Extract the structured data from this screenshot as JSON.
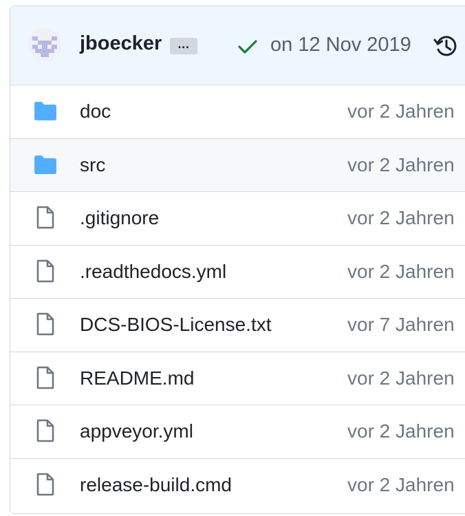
{
  "commit": {
    "author": "jboecker",
    "ellipsis": "…",
    "date": "on 12 Nov 2019",
    "status": "success",
    "status_color": "#1a7f37"
  },
  "files": [
    {
      "name": "doc",
      "type": "folder",
      "age": "vor 2 Jahren"
    },
    {
      "name": "src",
      "type": "folder",
      "age": "vor 2 Jahren"
    },
    {
      "name": ".gitignore",
      "type": "file",
      "age": "vor 2 Jahren"
    },
    {
      "name": ".readthedocs.yml",
      "type": "file",
      "age": "vor 2 Jahren"
    },
    {
      "name": "DCS-BIOS-License.txt",
      "type": "file",
      "age": "vor 7 Jahren"
    },
    {
      "name": "README.md",
      "type": "file",
      "age": "vor 2 Jahren"
    },
    {
      "name": "appveyor.yml",
      "type": "file",
      "age": "vor 2 Jahren"
    },
    {
      "name": "release-build.cmd",
      "type": "file",
      "age": "vor 2 Jahren"
    }
  ],
  "colors": {
    "folder": "#54aeff",
    "file_outline": "#6e7781",
    "header_bg": "#eef6ff"
  },
  "icons": {
    "folder": "folder-icon",
    "file": "file-icon",
    "history": "history-icon",
    "check": "check-icon"
  }
}
